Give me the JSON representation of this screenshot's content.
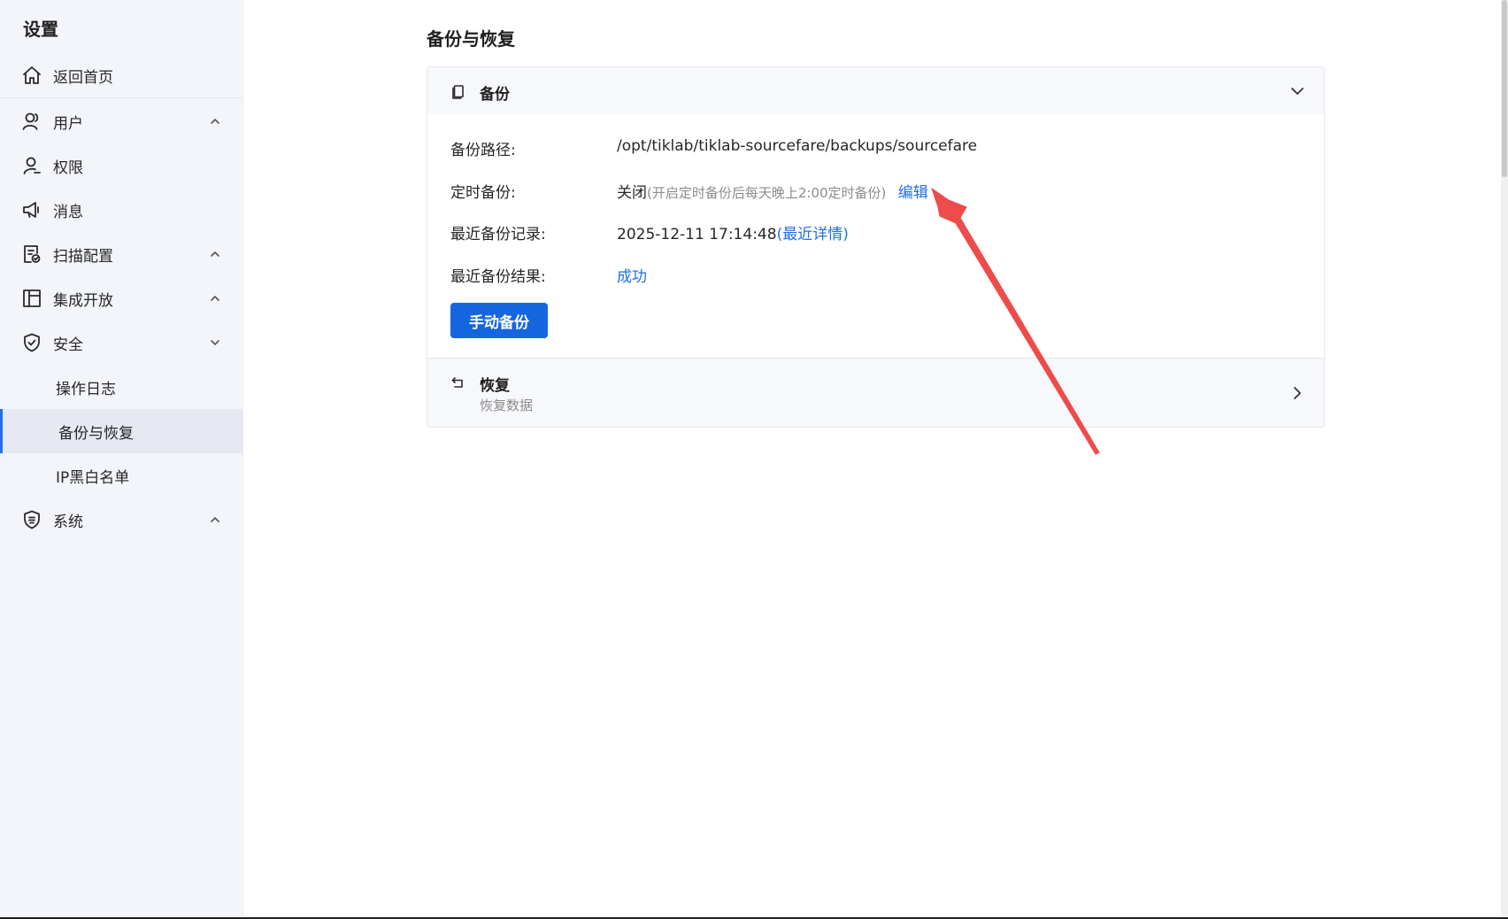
{
  "sidebar": {
    "title": "设置",
    "items": [
      {
        "label": "返回首页"
      },
      {
        "label": "用户"
      },
      {
        "label": "权限"
      },
      {
        "label": "消息"
      },
      {
        "label": "扫描配置"
      },
      {
        "label": "集成开放"
      },
      {
        "label": "安全"
      },
      {
        "label": "操作日志"
      },
      {
        "label": "备份与恢复"
      },
      {
        "label": "IP黑白名单"
      },
      {
        "label": "系统"
      }
    ]
  },
  "main": {
    "page_title": "备份与恢复",
    "backup": {
      "header": "备份",
      "path_label": "备份路径:",
      "path_value": "/opt/tiklab/tiklab-sourcefare/backups/sourcefare",
      "schedule_label": "定时备份:",
      "schedule_value": "关闭",
      "schedule_hint": "(开启定时备份后每天晚上2:00定时备份)",
      "schedule_edit": "编辑",
      "recent_label": "最近备份记录:",
      "recent_value": "2025-12-11 17:14:48",
      "recent_detail": "(最近详情)",
      "result_label": "最近备份结果:",
      "result_value": "成功",
      "manual_button": "手动备份"
    },
    "restore": {
      "title": "恢复",
      "subtitle": "恢复数据"
    }
  },
  "colors": {
    "accent": "#1565e0",
    "link": "#1f6fe5",
    "annotation": "#ee4b4b"
  }
}
